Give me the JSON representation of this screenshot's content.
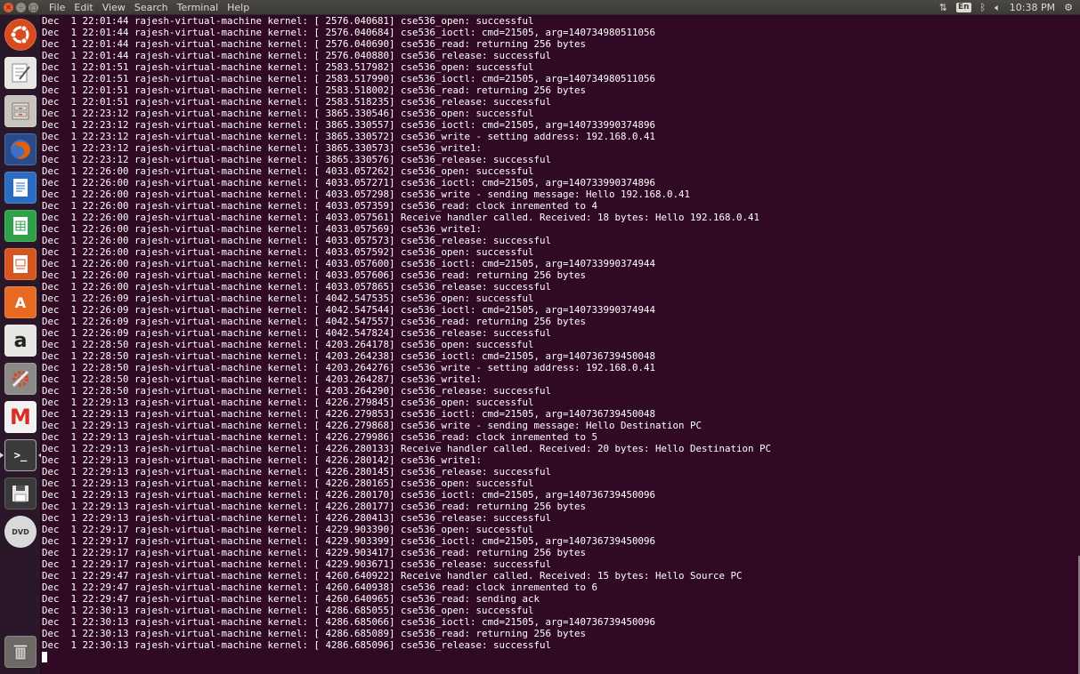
{
  "topbar": {
    "menus": [
      "File",
      "Edit",
      "View",
      "Search",
      "Terminal",
      "Help"
    ],
    "lang": "En",
    "time": "10:38 PM",
    "icons": [
      "network-updown-icon",
      "bluetooth-icon",
      "volume-icon",
      "gear-icon"
    ]
  },
  "launcher": {
    "items": [
      {
        "name": "ubuntu-dash",
        "glyph": "",
        "color": "#d84b1f"
      },
      {
        "name": "text-editor",
        "glyph": "",
        "color": "#e9e7e3"
      },
      {
        "name": "files",
        "glyph": "",
        "color": "#c9c4bd"
      },
      {
        "name": "firefox",
        "glyph": "",
        "color": "#e66000"
      },
      {
        "name": "libreoffice-writer",
        "glyph": "",
        "color": "#2a6cc4"
      },
      {
        "name": "libreoffice-calc",
        "glyph": "",
        "color": "#2ea149"
      },
      {
        "name": "libreoffice-impress",
        "glyph": "",
        "color": "#d5571f"
      },
      {
        "name": "software-center",
        "glyph": "A",
        "color": "#e86a22"
      },
      {
        "name": "amazon",
        "glyph": "a",
        "color": "#e8e6e2"
      },
      {
        "name": "system-settings",
        "glyph": "",
        "color": "#d8492c"
      },
      {
        "name": "gmail",
        "glyph": "M",
        "color": "#f2f2f2"
      },
      {
        "name": "terminal",
        "glyph": ">_",
        "color": "#3b3b3b"
      },
      {
        "name": "save-disk",
        "glyph": "",
        "color": "#3a3a3a"
      },
      {
        "name": "dvd",
        "glyph": "DVD",
        "color": "#d9d9d9"
      },
      {
        "name": "trash",
        "glyph": "",
        "color": "#6d6a66"
      }
    ]
  },
  "terminal": {
    "lines": [
      "Dec  1 22:01:44 rajesh-virtual-machine kernel: [ 2576.040681] cse536_open: successful",
      "Dec  1 22:01:44 rajesh-virtual-machine kernel: [ 2576.040684] cse536_ioctl: cmd=21505, arg=140734980511056",
      "Dec  1 22:01:44 rajesh-virtual-machine kernel: [ 2576.040690] cse536_read: returning 256 bytes",
      "Dec  1 22:01:44 rajesh-virtual-machine kernel: [ 2576.040880] cse536_release: successful",
      "Dec  1 22:01:51 rajesh-virtual-machine kernel: [ 2583.517982] cse536_open: successful",
      "Dec  1 22:01:51 rajesh-virtual-machine kernel: [ 2583.517990] cse536_ioctl: cmd=21505, arg=140734980511056",
      "Dec  1 22:01:51 rajesh-virtual-machine kernel: [ 2583.518002] cse536_read: returning 256 bytes",
      "Dec  1 22:01:51 rajesh-virtual-machine kernel: [ 2583.518235] cse536_release: successful",
      "Dec  1 22:23:12 rajesh-virtual-machine kernel: [ 3865.330546] cse536_open: successful",
      "Dec  1 22:23:12 rajesh-virtual-machine kernel: [ 3865.330557] cse536_ioctl: cmd=21505, arg=140733990374896",
      "Dec  1 22:23:12 rajesh-virtual-machine kernel: [ 3865.330572] cse536_write - setting address: 192.168.0.41",
      "Dec  1 22:23:12 rajesh-virtual-machine kernel: [ 3865.330573] cse536_write1:",
      "Dec  1 22:23:12 rajesh-virtual-machine kernel: [ 3865.330576] cse536_release: successful",
      "Dec  1 22:26:00 rajesh-virtual-machine kernel: [ 4033.057262] cse536_open: successful",
      "Dec  1 22:26:00 rajesh-virtual-machine kernel: [ 4033.057271] cse536_ioctl: cmd=21505, arg=140733990374896",
      "Dec  1 22:26:00 rajesh-virtual-machine kernel: [ 4033.057298] cse536_write - sending message: Hello 192.168.0.41",
      "Dec  1 22:26:00 rajesh-virtual-machine kernel: [ 4033.057359] cse536_read: clock inremented to 4",
      "Dec  1 22:26:00 rajesh-virtual-machine kernel: [ 4033.057561] Receive handler called. Received: 18 bytes: Hello 192.168.0.41",
      "Dec  1 22:26:00 rajesh-virtual-machine kernel: [ 4033.057569] cse536_write1:",
      "Dec  1 22:26:00 rajesh-virtual-machine kernel: [ 4033.057573] cse536_release: successful",
      "Dec  1 22:26:00 rajesh-virtual-machine kernel: [ 4033.057592] cse536_open: successful",
      "Dec  1 22:26:00 rajesh-virtual-machine kernel: [ 4033.057600] cse536_ioctl: cmd=21505, arg=140733990374944",
      "Dec  1 22:26:00 rajesh-virtual-machine kernel: [ 4033.057606] cse536_read: returning 256 bytes",
      "Dec  1 22:26:00 rajesh-virtual-machine kernel: [ 4033.057865] cse536_release: successful",
      "Dec  1 22:26:09 rajesh-virtual-machine kernel: [ 4042.547535] cse536_open: successful",
      "Dec  1 22:26:09 rajesh-virtual-machine kernel: [ 4042.547544] cse536_ioctl: cmd=21505, arg=140733990374944",
      "Dec  1 22:26:09 rajesh-virtual-machine kernel: [ 4042.547557] cse536_read: returning 256 bytes",
      "Dec  1 22:26:09 rajesh-virtual-machine kernel: [ 4042.547824] cse536_release: successful",
      "Dec  1 22:28:50 rajesh-virtual-machine kernel: [ 4203.264178] cse536_open: successful",
      "Dec  1 22:28:50 rajesh-virtual-machine kernel: [ 4203.264238] cse536_ioctl: cmd=21505, arg=140736739450048",
      "Dec  1 22:28:50 rajesh-virtual-machine kernel: [ 4203.264276] cse536_write - setting address: 192.168.0.41",
      "Dec  1 22:28:50 rajesh-virtual-machine kernel: [ 4203.264287] cse536_write1:",
      "Dec  1 22:28:50 rajesh-virtual-machine kernel: [ 4203.264290] cse536_release: successful",
      "Dec  1 22:29:13 rajesh-virtual-machine kernel: [ 4226.279845] cse536_open: successful",
      "Dec  1 22:29:13 rajesh-virtual-machine kernel: [ 4226.279853] cse536_ioctl: cmd=21505, arg=140736739450048",
      "Dec  1 22:29:13 rajesh-virtual-machine kernel: [ 4226.279868] cse536_write - sending message: Hello Destination PC",
      "Dec  1 22:29:13 rajesh-virtual-machine kernel: [ 4226.279986] cse536_read: clock inremented to 5",
      "Dec  1 22:29:13 rajesh-virtual-machine kernel: [ 4226.280133] Receive handler called. Received: 20 bytes: Hello Destination PC",
      "Dec  1 22:29:13 rajesh-virtual-machine kernel: [ 4226.280142] cse536_write1:",
      "Dec  1 22:29:13 rajesh-virtual-machine kernel: [ 4226.280145] cse536_release: successful",
      "Dec  1 22:29:13 rajesh-virtual-machine kernel: [ 4226.280165] cse536_open: successful",
      "Dec  1 22:29:13 rajesh-virtual-machine kernel: [ 4226.280170] cse536_ioctl: cmd=21505, arg=140736739450096",
      "Dec  1 22:29:13 rajesh-virtual-machine kernel: [ 4226.280177] cse536_read: returning 256 bytes",
      "Dec  1 22:29:13 rajesh-virtual-machine kernel: [ 4226.280413] cse536_release: successful",
      "Dec  1 22:29:17 rajesh-virtual-machine kernel: [ 4229.903390] cse536_open: successful",
      "Dec  1 22:29:17 rajesh-virtual-machine kernel: [ 4229.903399] cse536_ioctl: cmd=21505, arg=140736739450096",
      "Dec  1 22:29:17 rajesh-virtual-machine kernel: [ 4229.903417] cse536_read: returning 256 bytes",
      "Dec  1 22:29:17 rajesh-virtual-machine kernel: [ 4229.903671] cse536_release: successful",
      "Dec  1 22:29:47 rajesh-virtual-machine kernel: [ 4260.640922] Receive handler called. Received: 15 bytes: Hello Source PC",
      "Dec  1 22:29:47 rajesh-virtual-machine kernel: [ 4260.640938] cse536_read: clock inremented to 6",
      "Dec  1 22:29:47 rajesh-virtual-machine kernel: [ 4260.640965] cse536_read: sending ack",
      "Dec  1 22:30:13 rajesh-virtual-machine kernel: [ 4286.685055] cse536_open: successful",
      "Dec  1 22:30:13 rajesh-virtual-machine kernel: [ 4286.685066] cse536_ioctl: cmd=21505, arg=140736739450096",
      "Dec  1 22:30:13 rajesh-virtual-machine kernel: [ 4286.685089] cse536_read: returning 256 bytes",
      "Dec  1 22:30:13 rajesh-virtual-machine kernel: [ 4286.685096] cse536_release: successful"
    ]
  },
  "colors": {
    "terminal_bg": "#300a24",
    "terminal_fg": "#ffffff",
    "panel_bg": "#3c3b37",
    "launcher_bg": "#2a1729"
  }
}
